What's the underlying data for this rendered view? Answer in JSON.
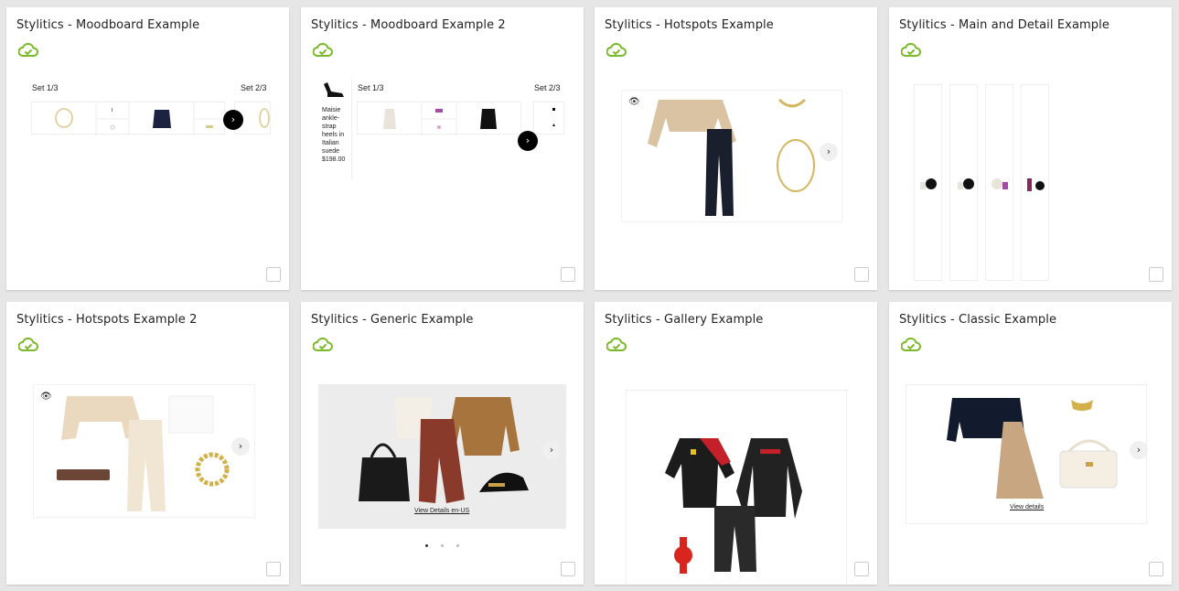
{
  "cards": [
    {
      "title": "Stylitics - Moodboard Example",
      "status_icon": "cloud-check-icon",
      "sets": [
        "Set 1/3",
        "Set 2/3"
      ]
    },
    {
      "title": "Stylitics - Moodboard Example 2",
      "status_icon": "cloud-check-icon",
      "sets": [
        "Set 1/3",
        "Set 2/3"
      ],
      "product_name": "Maisie ankle-strap heels in Italian suede",
      "product_price": "$198.00"
    },
    {
      "title": "Stylitics - Hotspots Example",
      "status_icon": "cloud-check-icon"
    },
    {
      "title": "Stylitics - Main and Detail Example",
      "status_icon": "cloud-check-icon"
    },
    {
      "title": "Stylitics - Hotspots Example 2",
      "status_icon": "cloud-check-icon"
    },
    {
      "title": "Stylitics - Generic Example",
      "status_icon": "cloud-check-icon",
      "link": "View Details en-US"
    },
    {
      "title": "Stylitics - Gallery Example",
      "status_icon": "cloud-check-icon"
    },
    {
      "title": "Stylitics - Classic Example",
      "status_icon": "cloud-check-icon",
      "link": "View details"
    }
  ],
  "colors": {
    "accent_green": "#7ab929",
    "page_bg": "#e6e6e6",
    "card_bg": "#ffffff"
  }
}
